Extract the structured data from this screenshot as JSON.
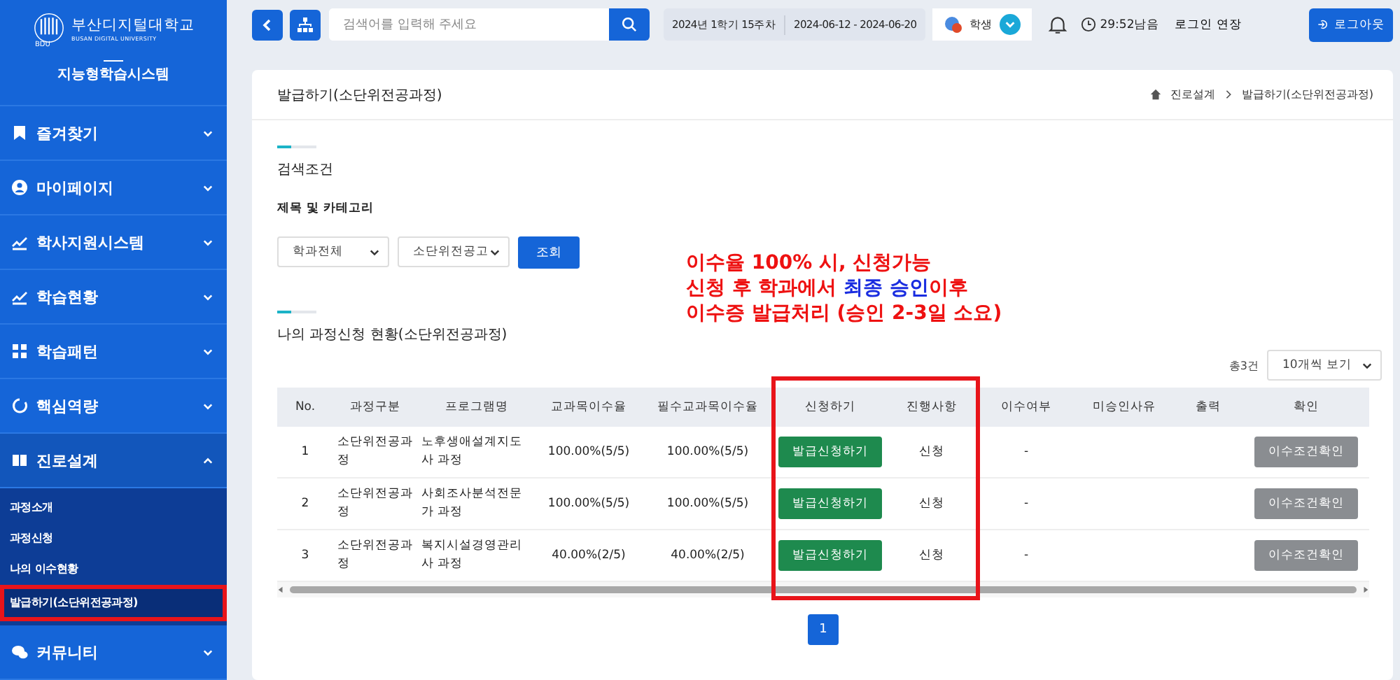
{
  "sidebar": {
    "logo": {
      "name": "부산디지털대학교",
      "subtitle": "BUSAN DIGITAL UNIVERSITY",
      "mark": "BDU"
    },
    "system_title": "지능형학습시스템",
    "items": [
      {
        "kind": "bookmark",
        "label": "즐겨찾기",
        "expanded": false
      },
      {
        "kind": "user",
        "label": "마이페이지",
        "expanded": false
      },
      {
        "kind": "chart",
        "label": "학사지원시스템",
        "expanded": false
      },
      {
        "kind": "chart",
        "label": "학습현황",
        "expanded": false
      },
      {
        "kind": "grid",
        "label": "학습패턴",
        "expanded": false
      },
      {
        "kind": "ring",
        "label": "핵심역량",
        "expanded": false
      },
      {
        "kind": "book",
        "label": "진로설계",
        "expanded": true,
        "children": [
          {
            "label": "과정소개",
            "selected": false,
            "highlighted": false
          },
          {
            "label": "과정신청",
            "selected": false,
            "highlighted": false
          },
          {
            "label": "나의 이수현황",
            "selected": false,
            "highlighted": false
          },
          {
            "label": "발급하기(소단위전공과정)",
            "selected": true,
            "highlighted": true
          }
        ]
      },
      {
        "kind": "chat",
        "label": "커뮤니티",
        "expanded": false
      }
    ]
  },
  "topbar": {
    "search": {
      "placeholder": "검색어를 입력해 주세요"
    },
    "semester": "2024년 1학기 15주차",
    "period": "2024-06-12 - 2024-06-20",
    "role": "학생",
    "timer": "29:52남음",
    "extend": "로그인 연장",
    "logout": "로그아웃"
  },
  "page": {
    "title": "발급하기(소단위전공과정)",
    "breadcrumb": [
      "진로설계",
      "발급하기(소단위전공과정)"
    ],
    "search_section": {
      "title": "검색조건",
      "filter_label": "제목 및 카테고리",
      "selects": [
        "학과전체",
        "소단위전공고"
      ],
      "button": "조회"
    },
    "list_section": {
      "title": "나의 과정신청 현황(소단위전공과정)",
      "total": "총3건",
      "page_size": "10개씩 보기",
      "columns": [
        "No.",
        "과정구분",
        "프로그램명",
        "교과목이수율",
        "필수교과목이수율",
        "신청하기",
        "진행사항",
        "이수여부",
        "미승인사유",
        "출력",
        "확인"
      ],
      "rows": [
        {
          "no": "1",
          "type": "소단위전공과정",
          "program": "노후생애설계지도사 과정",
          "rate": "100.00%(5/5)",
          "required_rate": "100.00%(5/5)",
          "apply": "발급신청하기",
          "status": "신청",
          "completed": "-",
          "reason": "",
          "print": "",
          "check": "이수조건확인"
        },
        {
          "no": "2",
          "type": "소단위전공과정",
          "program": "사회조사분석전문가 과정",
          "rate": "100.00%(5/5)",
          "required_rate": "100.00%(5/5)",
          "apply": "발급신청하기",
          "status": "신청",
          "completed": "-",
          "reason": "",
          "print": "",
          "check": "이수조건확인"
        },
        {
          "no": "3",
          "type": "소단위전공과정",
          "program": "복지시설경영관리사 과정",
          "rate": "40.00%(2/5)",
          "required_rate": "40.00%(2/5)",
          "apply": "발급신청하기",
          "status": "신청",
          "completed": "-",
          "reason": "",
          "print": "",
          "check": "이수조건확인"
        }
      ],
      "pages": [
        {
          "label": "1",
          "selected": true
        }
      ]
    }
  },
  "annotation": {
    "lines": [
      [
        {
          "text": "이수율 100% 시, 신청가능",
          "emphasis": false
        }
      ],
      [
        {
          "text": "신청 후 학과에서 ",
          "emphasis": false
        },
        {
          "text": "최종 승인",
          "emphasis": true
        },
        {
          "text": "이후",
          "emphasis": false
        }
      ],
      [
        {
          "text": "이수증 발급처리 (승인 2-3일 소요)",
          "emphasis": false
        }
      ]
    ]
  }
}
